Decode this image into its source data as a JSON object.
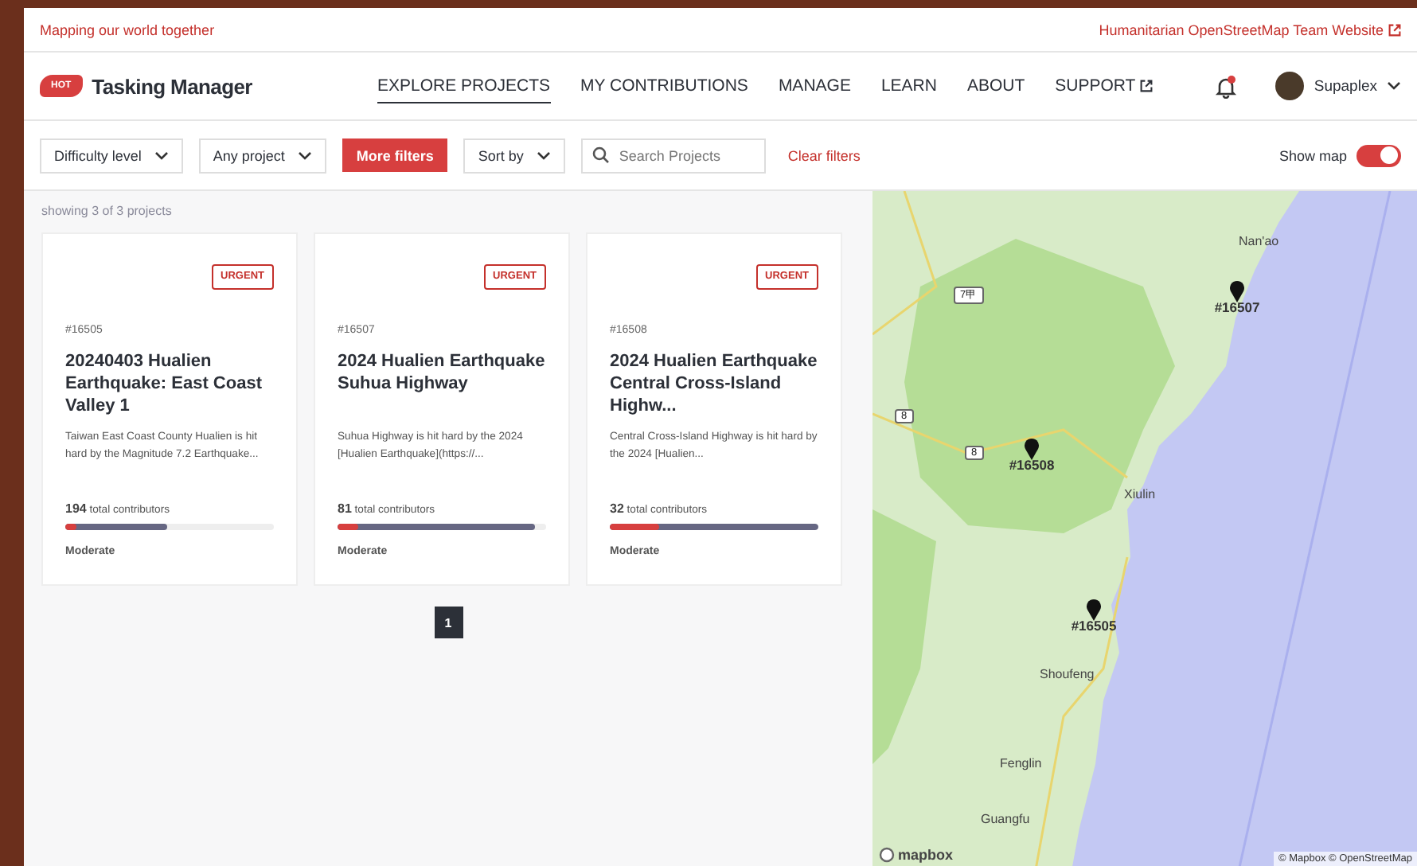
{
  "top_bar": {
    "tagline": "Mapping our world together",
    "link": "Humanitarian OpenStreetMap Team Website"
  },
  "header": {
    "logo_text": "HOT",
    "app_name": "Tasking Manager",
    "nav": [
      {
        "label": "EXPLORE PROJECTS",
        "selected": true,
        "external": false
      },
      {
        "label": "MY CONTRIBUTIONS",
        "selected": false,
        "external": false
      },
      {
        "label": "MANAGE",
        "selected": false,
        "external": false
      },
      {
        "label": "LEARN",
        "selected": false,
        "external": false
      },
      {
        "label": "ABOUT",
        "selected": false,
        "external": false
      },
      {
        "label": "SUPPORT",
        "selected": false,
        "external": true
      }
    ],
    "notifications": {
      "unread": true
    },
    "user": {
      "name": "Supaplex"
    }
  },
  "filters": {
    "controls": [
      {
        "kind": "dropdown",
        "label": "Difficulty level"
      },
      {
        "kind": "dropdown",
        "label": "Any project"
      },
      {
        "kind": "button",
        "label": "More filters"
      },
      {
        "kind": "dropdown",
        "label": "Sort by"
      }
    ],
    "search": {
      "placeholder": "Search Projects"
    },
    "clear": "Clear filters",
    "show_map": {
      "label": "Show map",
      "on": true
    }
  },
  "results": {
    "count_text": "showing 3 of 3 projects"
  },
  "projects": [
    {
      "urgent": true,
      "urgent_label": "URGENT",
      "id": "#16505",
      "title": "20240403 Hualien Earthquake: East Coast Valley 1",
      "description": "Taiwan East Coast County Hualien is hit hard by the Magnitude 7.2 Earthquake...",
      "contributors": "194",
      "contributors_label": "total contributors",
      "mapped": {
        "level": 0.49
      },
      "validated": {
        "level": 0.05
      },
      "difficulty": "Moderate"
    },
    {
      "urgent": true,
      "urgent_label": "URGENT",
      "id": "#16507",
      "title": "2024 Hualien Earthquake Suhua Highway",
      "description": "Suhua Highway is hit hard by the 2024 [Hualien Earthquake](https://...",
      "contributors": "81",
      "contributors_label": "total contributors",
      "mapped": {
        "level": 0.95
      },
      "validated": {
        "level": 0.1
      },
      "difficulty": "Moderate"
    },
    {
      "urgent": true,
      "urgent_label": "URGENT",
      "id": "#16508",
      "title": "2024 Hualien Earthquake Central Cross-Island Highw...",
      "description": "Central Cross-Island Highway is hit hard by the 2024 [Hualien...",
      "contributors": "32",
      "contributors_label": "total contributors",
      "mapped": {
        "level": 1.0
      },
      "validated": {
        "level": 0.24
      },
      "difficulty": "Moderate"
    }
  ],
  "pagination": [
    {
      "label": "1",
      "selected": true
    }
  ],
  "map": {
    "places": [
      "Nan'ao",
      "Xiulin",
      "Shoufeng",
      "Fenglin",
      "Guangfu"
    ],
    "road_shields": [
      "7甲",
      "8",
      "8"
    ],
    "pins": [
      {
        "label": "#16507"
      },
      {
        "label": "#16508"
      },
      {
        "label": "#16505"
      }
    ],
    "logo": "mapbox",
    "attribution": "© Mapbox © OpenStreetMap"
  }
}
